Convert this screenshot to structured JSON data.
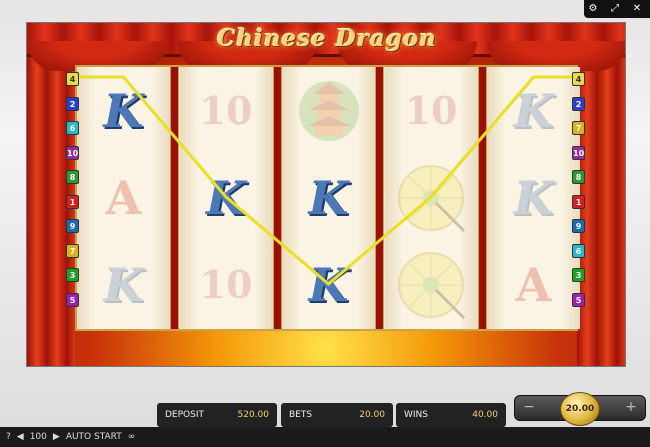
{
  "game": {
    "title": "Chinese Dragon"
  },
  "top_controls": [
    {
      "name": "settings-icon",
      "glyph": "⚙"
    },
    {
      "name": "fullscreen-icon",
      "glyph": "⤢"
    },
    {
      "name": "close-icon",
      "glyph": "✕"
    }
  ],
  "reels": [
    [
      {
        "symbol": "K",
        "winning": true
      },
      {
        "symbol": "A",
        "winning": false
      },
      {
        "symbol": "K",
        "winning": false
      }
    ],
    [
      {
        "symbol": "10",
        "winning": false
      },
      {
        "symbol": "K",
        "winning": true
      },
      {
        "symbol": "10",
        "winning": false
      }
    ],
    [
      {
        "symbol": "pagoda",
        "winning": false
      },
      {
        "symbol": "K",
        "winning": true
      },
      {
        "symbol": "K",
        "winning": true
      }
    ],
    [
      {
        "symbol": "10",
        "winning": false
      },
      {
        "symbol": "parasol",
        "winning": false
      },
      {
        "symbol": "parasol",
        "winning": false
      }
    ],
    [
      {
        "symbol": "K",
        "winning": false
      },
      {
        "symbol": "K",
        "winning": false
      },
      {
        "symbol": "A",
        "winning": false
      }
    ]
  ],
  "paylines_left": [
    {
      "num": "4",
      "color": "#e8d84a"
    },
    {
      "num": "2",
      "color": "#2a3fd0"
    },
    {
      "num": "6",
      "color": "#2ab8c8"
    },
    {
      "num": "10",
      "color": "#9a2a9a"
    },
    {
      "num": "8",
      "color": "#2a9a2a"
    },
    {
      "num": "1",
      "color": "#d02020"
    },
    {
      "num": "9",
      "color": "#1a6ab0"
    },
    {
      "num": "7",
      "color": "#d8b020"
    },
    {
      "num": "3",
      "color": "#20a020"
    },
    {
      "num": "5",
      "color": "#9a20b0"
    }
  ],
  "paylines_right": [
    {
      "num": "4",
      "color": "#e8d84a"
    },
    {
      "num": "2",
      "color": "#2a3fd0"
    },
    {
      "num": "7",
      "color": "#d8b020"
    },
    {
      "num": "10",
      "color": "#9a2a9a"
    },
    {
      "num": "8",
      "color": "#2a9a2a"
    },
    {
      "num": "1",
      "color": "#d02020"
    },
    {
      "num": "9",
      "color": "#1a6ab0"
    },
    {
      "num": "6",
      "color": "#2ab8c8"
    },
    {
      "num": "3",
      "color": "#20a020"
    },
    {
      "num": "5",
      "color": "#9a20b0"
    }
  ],
  "winning_line": {
    "number": "4",
    "color": "#e8e020"
  },
  "bottom_bar": {
    "help": "?",
    "prev": "◀",
    "autospins": "100",
    "next": "▶",
    "auto_start": "AUTO START",
    "infinity": "∞"
  },
  "stats": {
    "deposit_label": "DEPOSIT",
    "deposit_value": "520.00",
    "bets_label": "BETS",
    "bets_value": "20.00",
    "wins_label": "WINS",
    "wins_value": "40.00"
  },
  "stake": {
    "minus": "−",
    "value": "20.00",
    "plus": "+"
  }
}
